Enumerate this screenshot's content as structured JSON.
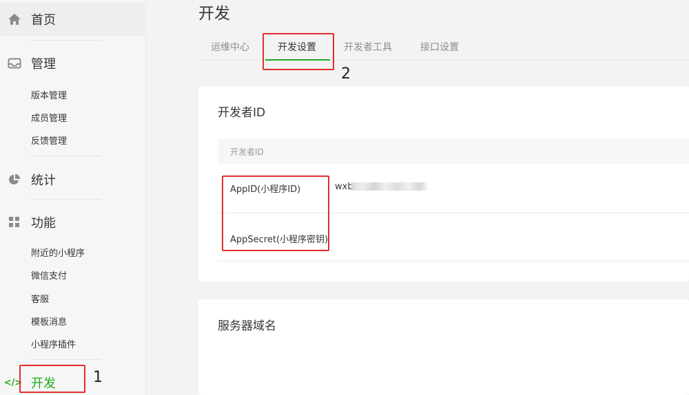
{
  "sidebar": {
    "home": {
      "label": "首页",
      "icon": "home-icon"
    },
    "manage": {
      "label": "管理",
      "icon": "inbox-icon",
      "items": [
        "版本管理",
        "成员管理",
        "反馈管理"
      ]
    },
    "stats": {
      "label": "统计",
      "icon": "pie-chart-icon"
    },
    "features": {
      "label": "功能",
      "icon": "grid-icon",
      "items": [
        "附近的小程序",
        "微信支付",
        "客服",
        "模板消息",
        "小程序插件"
      ]
    },
    "develop": {
      "label": "开发",
      "icon": "code-icon",
      "icon_text": "</>"
    }
  },
  "page": {
    "title": "开发",
    "tabs": [
      "运维中心",
      "开发设置",
      "开发者工具",
      "接口设置"
    ],
    "active_tab": "开发设置"
  },
  "developer_id": {
    "title": "开发者ID",
    "column_header": "开发者ID",
    "rows": [
      {
        "label": "AppID(小程序ID)",
        "value": "wxb"
      },
      {
        "label": "AppSecret(小程序密钥)",
        "value": ""
      }
    ]
  },
  "server_domain": {
    "title": "服务器域名"
  },
  "annotations": {
    "num1": "1",
    "num2": "2"
  },
  "colors": {
    "accent": "#1aad19",
    "annotation": "#e52b2b"
  }
}
